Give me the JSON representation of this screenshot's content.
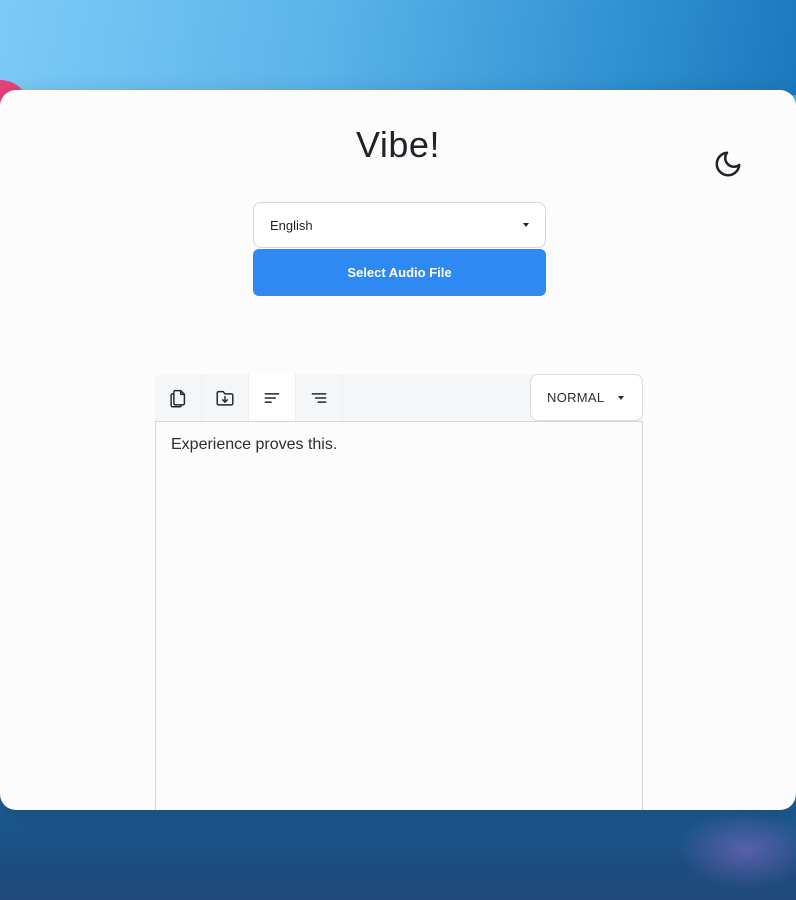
{
  "app": {
    "title": "Vibe!",
    "theme_toggle_icon": "moon-icon"
  },
  "language_select": {
    "value": "English",
    "icon": "chevron-down-icon"
  },
  "select_audio_button": {
    "label": "Select Audio File",
    "color": "#2f89f2"
  },
  "toolbar": {
    "buttons": [
      {
        "name": "copy",
        "icon": "copy-icon"
      },
      {
        "name": "download",
        "icon": "folder-download-icon"
      },
      {
        "name": "align-left",
        "icon": "align-left-icon",
        "active": true
      },
      {
        "name": "align-right",
        "icon": "align-right-icon"
      }
    ],
    "format_select": {
      "value": "NORMAL",
      "icon": "chevron-down-icon"
    }
  },
  "transcript": {
    "text": "Experience proves this."
  }
}
